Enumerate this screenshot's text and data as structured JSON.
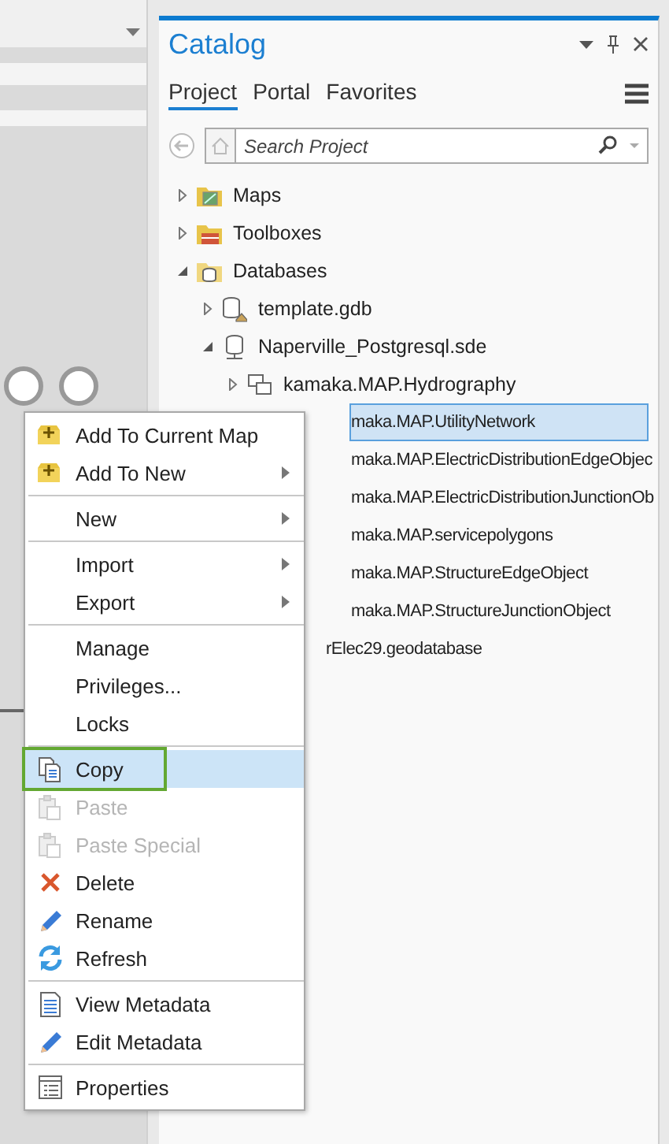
{
  "panel": {
    "title": "Catalog"
  },
  "tabs": [
    {
      "label": "Project",
      "selected": true
    },
    {
      "label": "Portal",
      "selected": false
    },
    {
      "label": "Favorites",
      "selected": false
    }
  ],
  "search": {
    "placeholder": "Search Project"
  },
  "tree": [
    {
      "label": "Maps",
      "kind": "maps",
      "expanded": false,
      "selected": false
    },
    {
      "label": "Toolboxes",
      "kind": "toolbox",
      "expanded": false,
      "selected": false
    },
    {
      "label": "Databases",
      "kind": "databases",
      "expanded": true,
      "selected": false,
      "children": [
        {
          "label": "template.gdb",
          "kind": "gdb",
          "expanded": false,
          "selected": false
        },
        {
          "label": "Naperville_Postgresql.sde",
          "kind": "sde",
          "expanded": true,
          "selected": false,
          "children": [
            {
              "label": "kamaka.MAP.Hydrography",
              "kind": "dataset",
              "expanded": false,
              "selected": false
            },
            {
              "label": "maka.MAP.UtilityNetwork",
              "kind": "covered",
              "selected": true
            },
            {
              "label": "maka.MAP.ElectricDistributionEdgeObjec",
              "kind": "covered",
              "selected": false
            },
            {
              "label": "maka.MAP.ElectricDistributionJunctionOb",
              "kind": "covered",
              "selected": false
            },
            {
              "label": "maka.MAP.servicepolygons",
              "kind": "covered",
              "selected": false
            },
            {
              "label": "maka.MAP.StructureEdgeObject",
              "kind": "covered",
              "selected": false
            },
            {
              "label": "maka.MAP.StructureJunctionObject",
              "kind": "covered",
              "selected": false
            }
          ]
        },
        {
          "label": "rElec29.geodatabase",
          "kind": "covered",
          "selected": false
        }
      ]
    }
  ],
  "context_menu": [
    [
      {
        "label": "Add To Current Map",
        "kind": "add",
        "submenu": false,
        "disabled": false,
        "highlighted": false,
        "outlined": false
      },
      {
        "label": "Add To New",
        "kind": "add",
        "submenu": true,
        "disabled": false,
        "highlighted": false,
        "outlined": false
      }
    ],
    [
      {
        "label": "New",
        "submenu": true,
        "disabled": false,
        "highlighted": false,
        "outlined": false
      }
    ],
    [
      {
        "label": "Import",
        "submenu": true,
        "disabled": false,
        "highlighted": false,
        "outlined": false
      },
      {
        "label": "Export",
        "submenu": true,
        "disabled": false,
        "highlighted": false,
        "outlined": false
      }
    ],
    [
      {
        "label": "Manage",
        "submenu": false,
        "disabled": false,
        "highlighted": false,
        "outlined": false
      },
      {
        "label": "Privileges...",
        "submenu": false,
        "disabled": false,
        "highlighted": false,
        "outlined": false
      },
      {
        "label": "Locks",
        "submenu": false,
        "disabled": false,
        "highlighted": false,
        "outlined": false
      }
    ],
    [
      {
        "label": "Copy",
        "kind": "copy",
        "submenu": false,
        "disabled": false,
        "highlighted": true,
        "outlined": true
      },
      {
        "label": "Paste",
        "kind": "paste",
        "submenu": false,
        "disabled": true,
        "highlighted": false,
        "outlined": false
      },
      {
        "label": "Paste Special",
        "kind": "paste",
        "submenu": false,
        "disabled": true,
        "highlighted": false,
        "outlined": false
      },
      {
        "label": "Delete",
        "kind": "delete",
        "submenu": false,
        "disabled": false,
        "highlighted": false,
        "outlined": false
      },
      {
        "label": "Rename",
        "kind": "pencil",
        "submenu": false,
        "disabled": false,
        "highlighted": false,
        "outlined": false
      },
      {
        "label": "Refresh",
        "kind": "refresh",
        "submenu": false,
        "disabled": false,
        "highlighted": false,
        "outlined": false
      }
    ],
    [
      {
        "label": "View Metadata",
        "kind": "document",
        "submenu": false,
        "disabled": false,
        "highlighted": false,
        "outlined": false
      },
      {
        "label": "Edit Metadata",
        "kind": "pencil",
        "submenu": false,
        "disabled": false,
        "highlighted": false,
        "outlined": false
      }
    ],
    [
      {
        "label": "Properties",
        "kind": "properties",
        "submenu": false,
        "disabled": false,
        "highlighted": false,
        "outlined": false
      }
    ]
  ]
}
